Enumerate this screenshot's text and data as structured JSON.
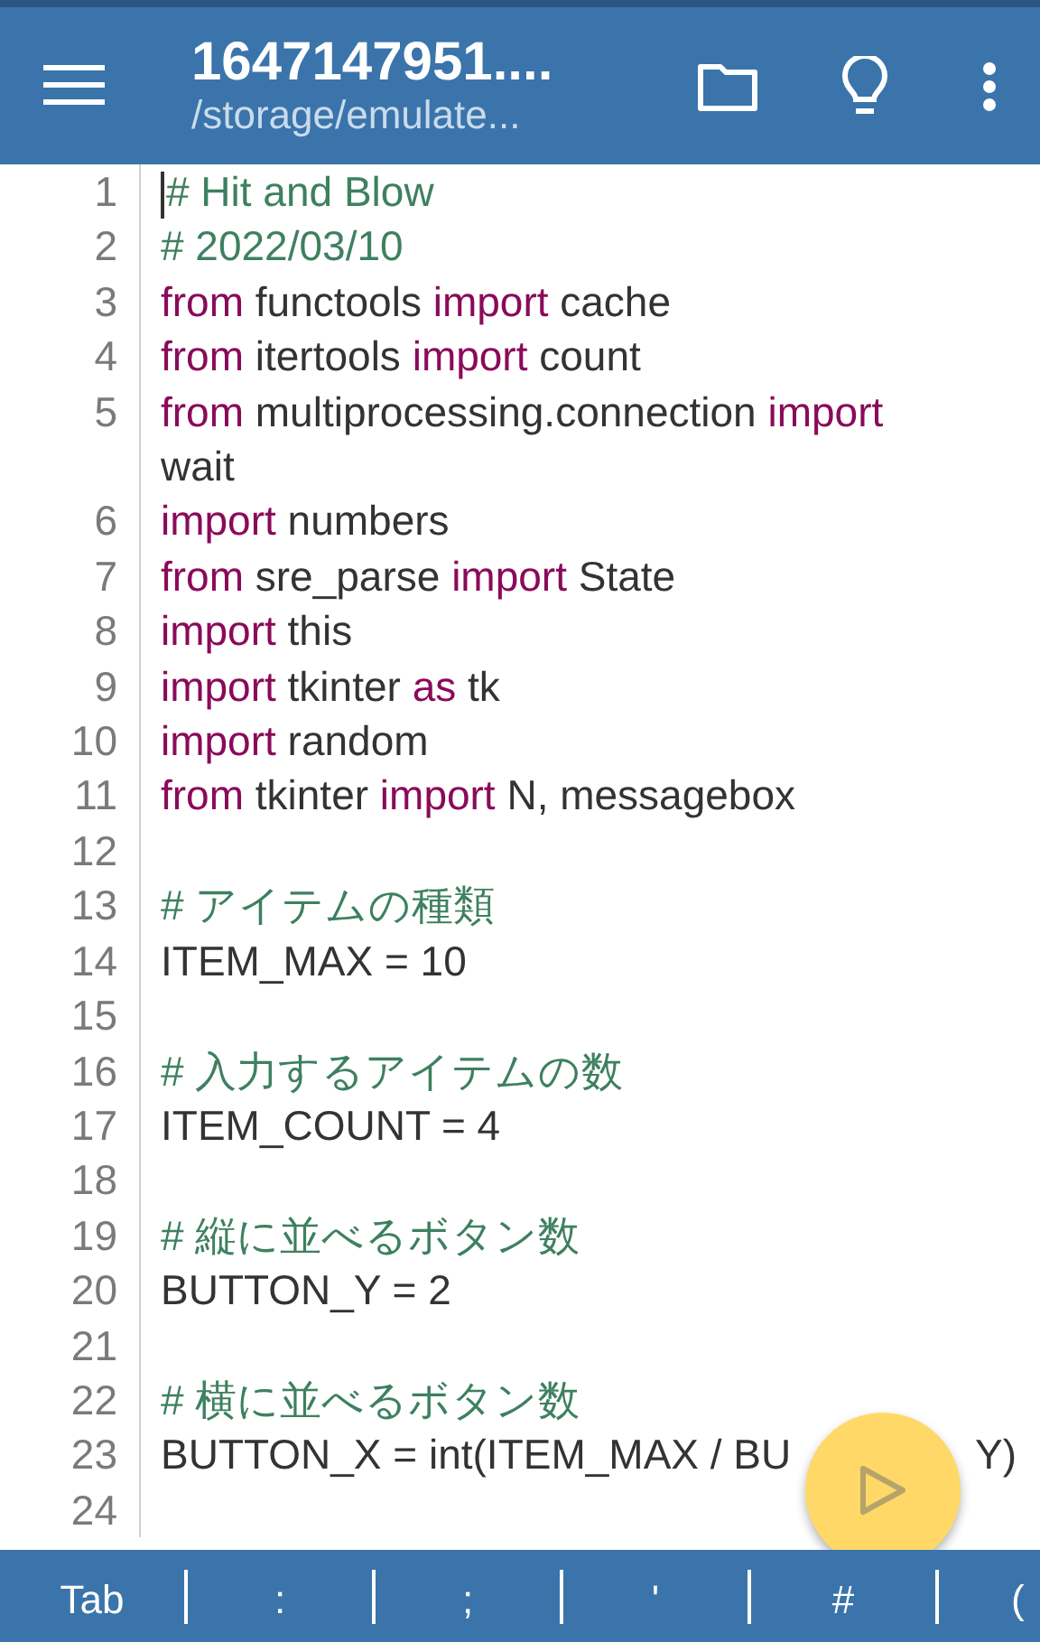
{
  "toolbar": {
    "title": "1647147951....",
    "subtitle": "/storage/emulate..."
  },
  "lines": [
    {
      "number": "1",
      "tokens": [
        {
          "text": "# Hit and Blow",
          "kind": "comment"
        }
      ],
      "cursor": true
    },
    {
      "number": "2",
      "tokens": [
        {
          "text": "# 2022/03/10",
          "kind": "comment"
        }
      ]
    },
    {
      "number": "3",
      "tokens": [
        {
          "text": "from",
          "kind": "keyword"
        },
        {
          "text": " functools ",
          "kind": "plain"
        },
        {
          "text": "import",
          "kind": "keyword"
        },
        {
          "text": " cache",
          "kind": "plain"
        }
      ]
    },
    {
      "number": "4",
      "tokens": [
        {
          "text": "from",
          "kind": "keyword"
        },
        {
          "text": " itertools ",
          "kind": "plain"
        },
        {
          "text": "import",
          "kind": "keyword"
        },
        {
          "text": " count",
          "kind": "plain"
        }
      ]
    },
    {
      "number": "5",
      "tokens": [
        {
          "text": "from",
          "kind": "keyword"
        },
        {
          "text": " multiprocessing.connection ",
          "kind": "plain"
        },
        {
          "text": "import",
          "kind": "keyword"
        },
        {
          "text": "wait",
          "kind": "wrapped"
        }
      ]
    },
    {
      "number": "6",
      "tokens": [
        {
          "text": "import",
          "kind": "keyword"
        },
        {
          "text": " numbers",
          "kind": "plain"
        }
      ]
    },
    {
      "number": "7",
      "tokens": [
        {
          "text": "from",
          "kind": "keyword"
        },
        {
          "text": " sre_parse ",
          "kind": "plain"
        },
        {
          "text": "import",
          "kind": "keyword"
        },
        {
          "text": " State",
          "kind": "plain"
        }
      ]
    },
    {
      "number": "8",
      "tokens": [
        {
          "text": "import",
          "kind": "keyword"
        },
        {
          "text": " this",
          "kind": "plain"
        }
      ]
    },
    {
      "number": "9",
      "tokens": [
        {
          "text": "import",
          "kind": "keyword"
        },
        {
          "text": " tkinter ",
          "kind": "plain"
        },
        {
          "text": "as",
          "kind": "keyword"
        },
        {
          "text": " tk",
          "kind": "plain"
        }
      ]
    },
    {
      "number": "10",
      "tokens": [
        {
          "text": "import",
          "kind": "keyword"
        },
        {
          "text": " random",
          "kind": "plain"
        }
      ]
    },
    {
      "number": "11",
      "tokens": [
        {
          "text": "from",
          "kind": "keyword"
        },
        {
          "text": " tkinter ",
          "kind": "plain"
        },
        {
          "text": "import",
          "kind": "keyword"
        },
        {
          "text": " N, messagebox",
          "kind": "plain"
        }
      ]
    },
    {
      "number": "12"
    },
    {
      "number": "13",
      "tokens": [
        {
          "text": "# アイテムの種類",
          "kind": "comment"
        }
      ]
    },
    {
      "number": "14",
      "tokens": [
        {
          "text": "ITEM_MAX = 10",
          "kind": "plain"
        }
      ]
    },
    {
      "number": "15"
    },
    {
      "number": "16",
      "tokens": [
        {
          "text": "# 入力するアイテムの数",
          "kind": "comment"
        }
      ]
    },
    {
      "number": "17",
      "tokens": [
        {
          "text": "ITEM_COUNT = 4",
          "kind": "plain"
        }
      ]
    },
    {
      "number": "18"
    },
    {
      "number": "19",
      "tokens": [
        {
          "text": "# 縦に並べるボタン数",
          "kind": "comment"
        }
      ]
    },
    {
      "number": "20",
      "tokens": [
        {
          "text": "BUTTON_Y = 2",
          "kind": "plain"
        }
      ]
    },
    {
      "number": "21"
    },
    {
      "number": "22",
      "tokens": [
        {
          "text": "# 横に並べるボタン数",
          "kind": "comment"
        }
      ]
    },
    {
      "number": "23",
      "tokens": [
        {
          "text": "BUTTON_X = int(ITEM_MAX / BU",
          "kind": "plain"
        },
        {
          "text": "Y)",
          "kind": "after_gap"
        }
      ]
    },
    {
      "number": "24"
    }
  ],
  "keys": [
    "Tab",
    ":",
    ";",
    "'",
    "#",
    "("
  ]
}
